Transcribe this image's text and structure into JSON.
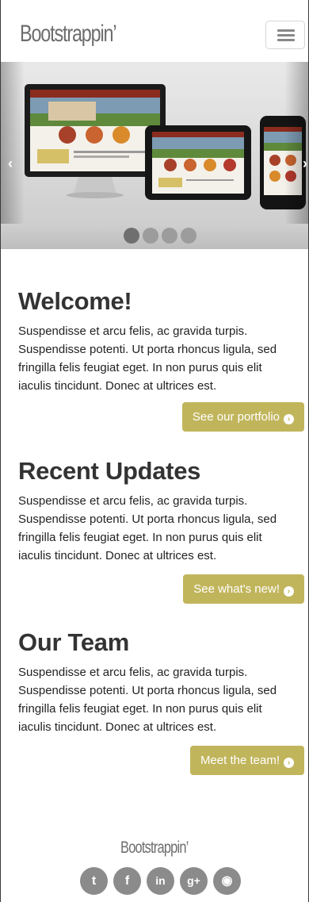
{
  "navbar": {
    "brand": "Bootstrappin’",
    "toggle_icon": "hamburger-icon"
  },
  "carousel": {
    "prev_icon": "‹",
    "next_icon": "›",
    "indicators": [
      {
        "active": true
      },
      {
        "active": false
      },
      {
        "active": false
      },
      {
        "active": false
      }
    ]
  },
  "sections": {
    "welcome": {
      "title": "Welcome!",
      "body": "Suspendisse et arcu felis, ac gravida turpis. Suspendisse potenti. Ut porta rhoncus ligula, sed fringilla felis feugiat eget. In non purus quis elit iaculis tincidunt. Donec at ultrices est.",
      "button": "See our portfolio"
    },
    "updates": {
      "title": "Recent Updates",
      "body": "Suspendisse et arcu felis, ac gravida turpis. Suspendisse potenti. Ut porta rhoncus ligula, sed fringilla felis feugiat eget. In non purus quis elit iaculis tincidunt. Donec at ultrices est.",
      "button": "See what's new!"
    },
    "team": {
      "title": "Our Team",
      "body": "Suspendisse et arcu felis, ac gravida turpis. Suspendisse potenti. Ut porta rhoncus ligula, sed fringilla felis feugiat eget. In non purus quis elit iaculis tincidunt. Donec at ultrices est.",
      "button": "Meet the team!"
    }
  },
  "button_icon": "circle-arrow-right-icon",
  "footer": {
    "brand": "Bootstrappin’",
    "social": [
      {
        "icon": "twitter-icon",
        "glyph": "t"
      },
      {
        "icon": "facebook-icon",
        "glyph": "f"
      },
      {
        "icon": "linkedin-icon",
        "glyph": "in"
      },
      {
        "icon": "google-plus-icon",
        "glyph": "g+"
      },
      {
        "icon": "github-icon",
        "glyph": "◉"
      }
    ]
  },
  "colors": {
    "accent": "#c1b55c",
    "brand_text": "#6d6d6d",
    "social_bg": "#8b8b8b"
  }
}
